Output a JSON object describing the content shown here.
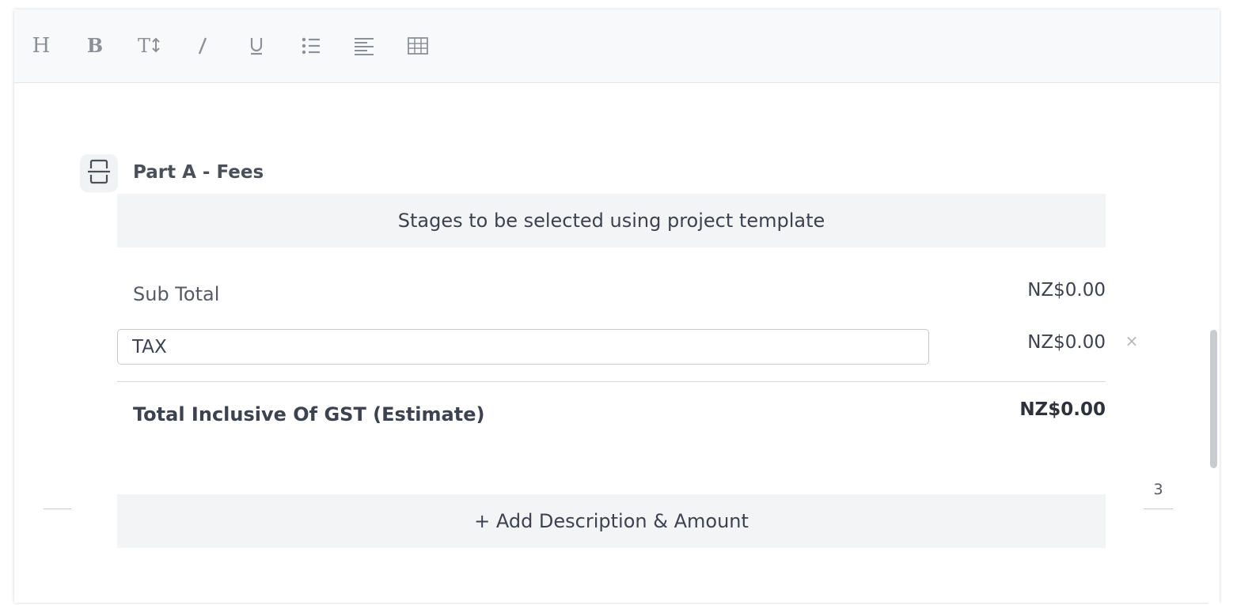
{
  "toolbar": {
    "buttons": [
      {
        "name": "heading-icon",
        "label": "H"
      },
      {
        "name": "bold-icon",
        "label": "B"
      },
      {
        "name": "text-size-icon",
        "label": "T↕"
      },
      {
        "name": "italic-icon",
        "label": "I"
      },
      {
        "name": "underline-icon",
        "label": "U"
      },
      {
        "name": "bullet-list-icon",
        "label": ""
      },
      {
        "name": "align-left-icon",
        "label": ""
      },
      {
        "name": "table-icon",
        "label": ""
      }
    ]
  },
  "section": {
    "icon": "page-break-icon",
    "title": "Part A - Fees",
    "stages_message": "Stages to be selected using project template",
    "subtotal": {
      "label": "Sub Total",
      "amount": "NZ$0.00"
    },
    "tax": {
      "value": "TAX",
      "amount": "NZ$0.00",
      "remove_icon": "×"
    },
    "total": {
      "label": "Total Inclusive Of GST (Estimate)",
      "amount": "NZ$0.00"
    },
    "add_button": "+ Add Description & Amount"
  },
  "page": {
    "number": "3"
  },
  "colors": {
    "toolbar_bg": "#f8f9fa",
    "panel_bg": "#f3f4f6",
    "text": "#3d4250",
    "icon": "#8c9099"
  }
}
